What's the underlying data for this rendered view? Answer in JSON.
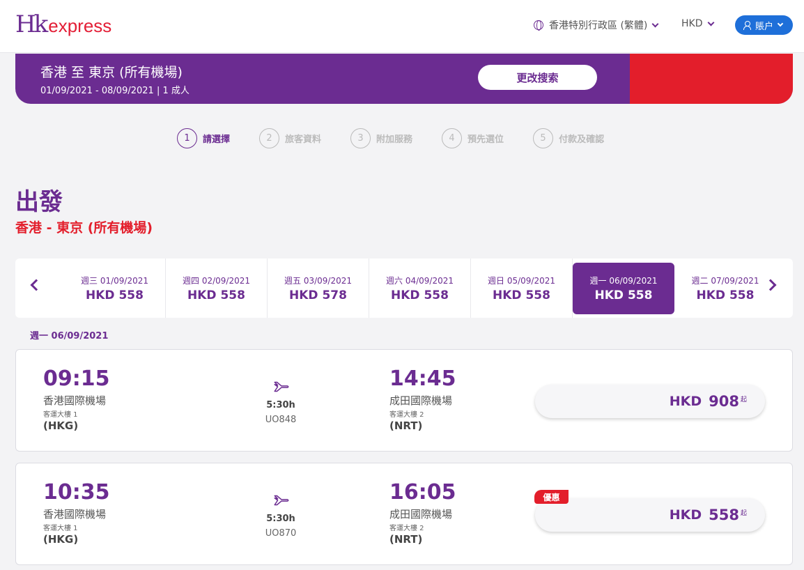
{
  "header": {
    "logo_hk": "Hk",
    "logo_express": "express",
    "language": "香港特別行政區 (繁體)",
    "currency": "HKD",
    "account": "賬户"
  },
  "search": {
    "route": "香港 至 東京 (所有機場)",
    "summary": "01/09/2021 - 08/09/2021 | 1 成人",
    "change_button": "更改搜索"
  },
  "steps": [
    {
      "num": "1",
      "label": "請選擇"
    },
    {
      "num": "2",
      "label": "旅客資料"
    },
    {
      "num": "3",
      "label": "附加服務"
    },
    {
      "num": "4",
      "label": "預先選位"
    },
    {
      "num": "5",
      "label": "付款及確認"
    }
  ],
  "section": {
    "title": "出發",
    "route": "香港 - 東京 (所有機場)"
  },
  "dates": [
    {
      "date": "週三 01/09/2021",
      "price": "HKD 558"
    },
    {
      "date": "週四 02/09/2021",
      "price": "HKD 558"
    },
    {
      "date": "週五 03/09/2021",
      "price": "HKD 578"
    },
    {
      "date": "週六 04/09/2021",
      "price": "HKD 558"
    },
    {
      "date": "週日 05/09/2021",
      "price": "HKD 558"
    },
    {
      "date": "週一 06/09/2021",
      "price": "HKD 558"
    },
    {
      "date": "週二 07/09/2021",
      "price": "HKD 558"
    }
  ],
  "selected_date": "週一 06/09/2021",
  "flights": [
    {
      "dep_time": "09:15",
      "dep_airport": "香港國際機場",
      "dep_terminal": "客運大樓 1",
      "dep_code": "(HKG)",
      "duration": "5:30h",
      "flight_no": "UO848",
      "arr_time": "14:45",
      "arr_airport": "成田國際機場",
      "arr_terminal": "客運大樓 2",
      "arr_code": "(NRT)",
      "currency": "HKD",
      "price": "908",
      "from": "起",
      "promo": ""
    },
    {
      "dep_time": "10:35",
      "dep_airport": "香港國際機場",
      "dep_terminal": "客運大樓 1",
      "dep_code": "(HKG)",
      "duration": "5:30h",
      "flight_no": "UO870",
      "arr_time": "16:05",
      "arr_airport": "成田國際機場",
      "arr_terminal": "客運大樓 2",
      "arr_code": "(NRT)",
      "currency": "HKD",
      "price": "558",
      "from": "起",
      "promo": "優惠"
    }
  ],
  "colors": {
    "brand_purple": "#6b2c91",
    "brand_red": "#e31e2b",
    "account_blue": "#1e6fd9"
  }
}
